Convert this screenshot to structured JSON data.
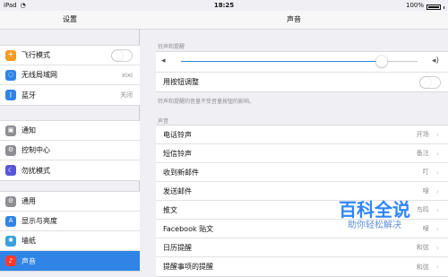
{
  "status": {
    "device": "iPad",
    "wifi_symbol": "◔",
    "time": "18:25",
    "battery_text": "100%"
  },
  "sidebar": {
    "title": "设置",
    "groups": [
      [
        {
          "label": "飞行模式",
          "icon": "airplane-icon",
          "icon_color": "#f59a23",
          "value": "",
          "toggle": "off"
        },
        {
          "label": "无线局域网",
          "icon": "wifi-icon",
          "icon_color": "#2f84e6",
          "value": "xixi"
        },
        {
          "label": "蓝牙",
          "icon": "bluetooth-icon",
          "icon_color": "#2f84e6",
          "value": "关闭"
        }
      ],
      [
        {
          "label": "通知",
          "icon": "notifications-icon",
          "icon_color": "#8e8e93"
        },
        {
          "label": "控制中心",
          "icon": "control-center-icon",
          "icon_color": "#8e8e93"
        },
        {
          "label": "勿扰模式",
          "icon": "do-not-disturb-icon",
          "icon_color": "#5856d6"
        }
      ],
      [
        {
          "label": "通用",
          "icon": "gear-icon",
          "icon_color": "#8e8e93"
        },
        {
          "label": "显示与亮度",
          "icon": "display-brightness-icon",
          "icon_color": "#2f84e6"
        },
        {
          "label": "墙纸",
          "icon": "wallpaper-icon",
          "icon_color": "#39a0dd"
        },
        {
          "label": "声音",
          "icon": "sound-icon",
          "icon_color": "#ff3b30",
          "selected": true
        }
      ]
    ]
  },
  "main": {
    "title": "声音",
    "ringer_label": "铃声和提醒",
    "change_with_buttons_label": "用按钮调整",
    "note": "铃声和提醒的音量不受音量按钮的影响。",
    "volume_level": 0.85,
    "sounds_label": "声音",
    "items": [
      {
        "label": "电话铃声",
        "value": "开场"
      },
      {
        "label": "短信铃声",
        "value": "备注"
      },
      {
        "label": "收到新邮件",
        "value": "叮"
      },
      {
        "label": "发送邮件",
        "value": "嗖"
      },
      {
        "label": "推文",
        "value": "鸟鸣"
      },
      {
        "label": "Facebook 贴文",
        "value": "嗖"
      },
      {
        "label": "日历提醒",
        "value": "和弦"
      },
      {
        "label": "提醒事项的提醒",
        "value": "和弦"
      }
    ]
  },
  "watermark": {
    "main": "百科全说",
    "sub": "助你轻松解决"
  }
}
